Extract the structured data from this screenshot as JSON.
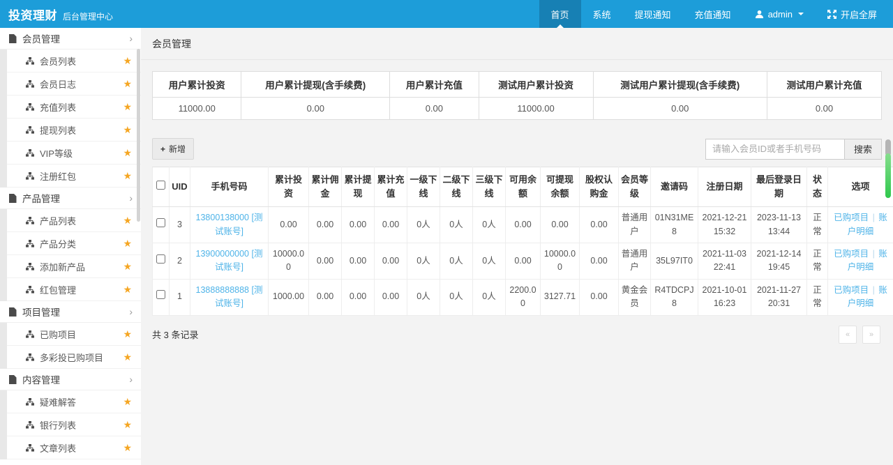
{
  "header": {
    "brand": "投资理财",
    "subtitle": "后台管理中心",
    "nav": [
      {
        "id": "home",
        "label": "首页",
        "active": true
      },
      {
        "id": "system",
        "label": "系统"
      },
      {
        "id": "withdraw-notice",
        "label": "提现通知"
      },
      {
        "id": "recharge-notice",
        "label": "充值通知"
      },
      {
        "id": "admin",
        "label": "admin",
        "icon": "user",
        "caret": true
      },
      {
        "id": "fullscreen",
        "label": "开启全屏",
        "icon": "fullscreen"
      }
    ]
  },
  "sidebar": {
    "groups": [
      {
        "id": "member",
        "label": "会员管理",
        "items": [
          {
            "id": "member-list",
            "label": "会员列表"
          },
          {
            "id": "member-log",
            "label": "会员日志"
          },
          {
            "id": "recharge-list",
            "label": "充值列表"
          },
          {
            "id": "withdraw-list",
            "label": "提现列表"
          },
          {
            "id": "vip-level",
            "label": "VIP等级"
          },
          {
            "id": "register-redpacket",
            "label": "注册红包"
          }
        ]
      },
      {
        "id": "product",
        "label": "产品管理",
        "items": [
          {
            "id": "product-list",
            "label": "产品列表"
          },
          {
            "id": "product-category",
            "label": "产品分类"
          },
          {
            "id": "add-product",
            "label": "添加新产品"
          },
          {
            "id": "redpacket-manage",
            "label": "红包管理"
          }
        ]
      },
      {
        "id": "project",
        "label": "项目管理",
        "items": [
          {
            "id": "purchased-projects",
            "label": "已购项目"
          },
          {
            "id": "duocaitou-purchased-projects",
            "label": "多彩投已购项目"
          }
        ]
      },
      {
        "id": "content",
        "label": "内容管理",
        "items": [
          {
            "id": "faq",
            "label": "疑难解答"
          },
          {
            "id": "bank-list",
            "label": "银行列表"
          },
          {
            "id": "article-list",
            "label": "文章列表"
          }
        ]
      }
    ]
  },
  "page": {
    "title": "会员管理"
  },
  "stats": {
    "columns": [
      {
        "label": "用户累计投资",
        "value": "11000.00"
      },
      {
        "label": "用户累计提现(含手续费)",
        "value": "0.00"
      },
      {
        "label": "用户累计充值",
        "value": "0.00"
      },
      {
        "label": "测试用户累计投资",
        "value": "11000.00"
      },
      {
        "label": "测试用户累计提现(含手续费)",
        "value": "0.00"
      },
      {
        "label": "测试用户累计充值",
        "value": "0.00"
      }
    ]
  },
  "toolbar": {
    "add": "新增",
    "add_icon": "+",
    "search_placeholder": "请输入会员ID或者手机号码",
    "search": "搜索"
  },
  "table": {
    "columns": [
      "UID",
      "手机号码",
      "累计投资",
      "累计佣金",
      "累计提现",
      "累计充值",
      "一级下线",
      "二级下线",
      "三级下线",
      "可用余额",
      "可提现余额",
      "股权认购金",
      "会员等级",
      "邀请码",
      "注册日期",
      "最后登录日期",
      "状态",
      "选项"
    ],
    "rows": [
      {
        "uid": "3",
        "phone": "13800138000 [测试账号]",
        "values": [
          "0.00",
          "0.00",
          "0.00",
          "0.00",
          "0人",
          "0人",
          "0人",
          "0.00",
          "0.00",
          "0.00",
          "普通用户",
          "01N31ME8",
          "2021-12-21 15:32",
          "2023-11-13 13:44",
          "正常"
        ],
        "actions": [
          "已购项目",
          "账户明细"
        ]
      },
      {
        "uid": "2",
        "phone": "13900000000 [测试账号]",
        "values": [
          "10000.00",
          "0.00",
          "0.00",
          "0.00",
          "0人",
          "0人",
          "0人",
          "0.00",
          "10000.00",
          "0.00",
          "普通用户",
          "35L97IT0",
          "2021-11-03 22:41",
          "2021-12-14 19:45",
          "正常"
        ],
        "actions": [
          "已购项目",
          "账户明细"
        ]
      },
      {
        "uid": "1",
        "phone": "13888888888 [测试账号]",
        "values": [
          "1000.00",
          "0.00",
          "0.00",
          "0.00",
          "0人",
          "0人",
          "0人",
          "2200.00",
          "3127.71",
          "0.00",
          "黄金会员",
          "R4TDCPJ8",
          "2021-10-01 16:23",
          "2021-11-27 20:31",
          "正常"
        ],
        "actions": [
          "已购项目",
          "账户明细"
        ]
      }
    ],
    "action_separator": "|"
  },
  "footer": {
    "total": "共 3 条记录",
    "pager": [
      "«",
      "»"
    ]
  },
  "colors": {
    "accent": "#1d9dd9",
    "accent_dark": "#1780b4",
    "link": "#4eb3e8",
    "star": "#f5a623",
    "scroll_green": "#2fc84c"
  }
}
